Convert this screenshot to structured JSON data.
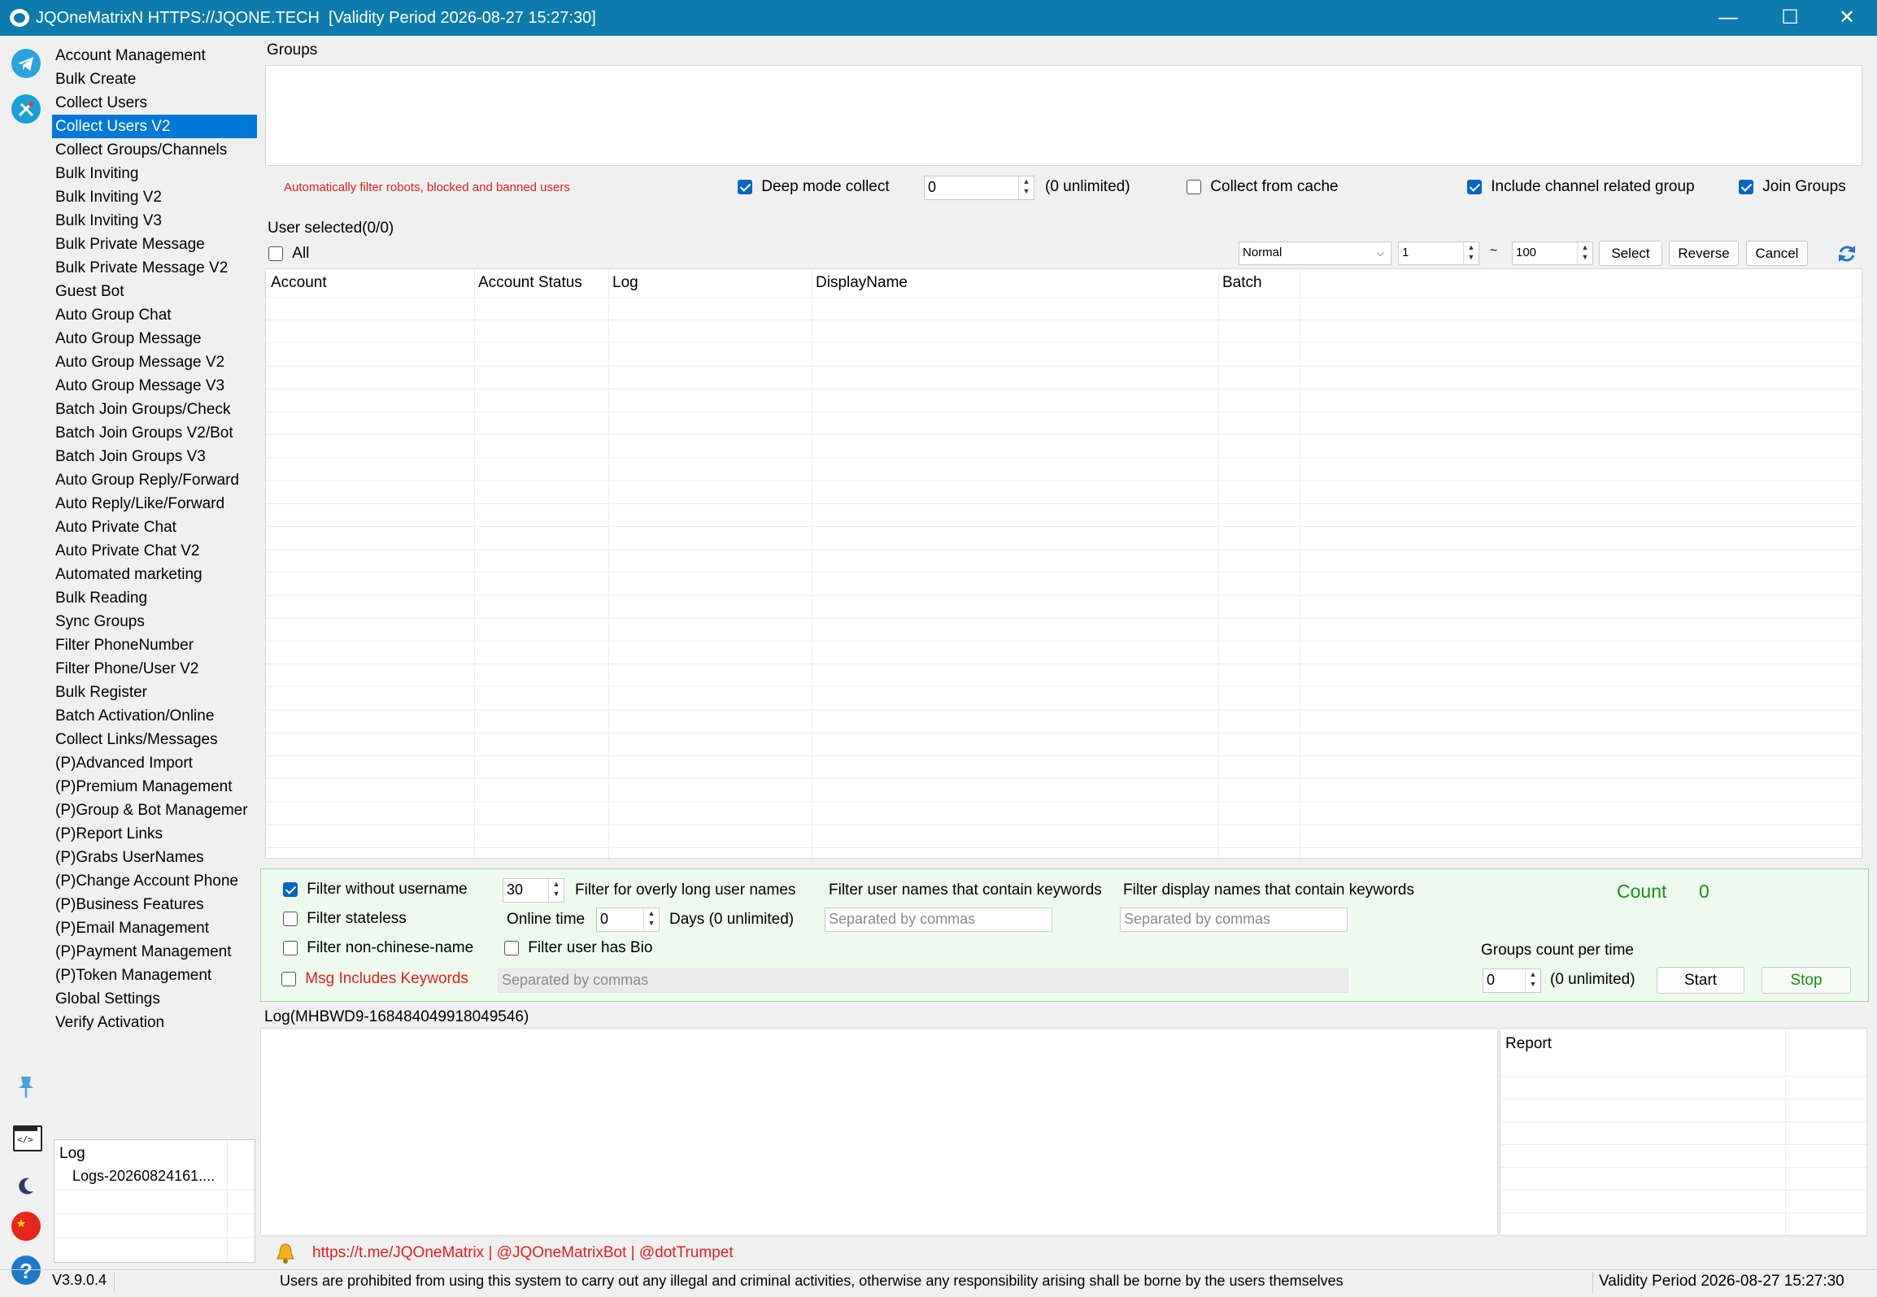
{
  "window": {
    "title": "JQOneMatrixN HTTPS://JQONE.TECH  [Validity Period 2026-08-27 15:27:30]",
    "minimize": "—",
    "maximize": "☐",
    "close": "✕"
  },
  "rail_icons": [
    "telegram-icon",
    "tools-icon",
    "pin-icon",
    "code-icon",
    "moon-icon",
    "china-flag-icon",
    "help-icon"
  ],
  "nav": {
    "items": [
      "Account Management",
      "Bulk Create",
      "Collect Users",
      "Collect Users V2",
      "Collect Groups/Channels",
      "Bulk Inviting",
      "Bulk Inviting V2",
      "Bulk Inviting V3",
      "Bulk Private Message",
      "Bulk Private Message V2",
      "Guest Bot",
      "Auto Group Chat",
      "Auto Group Message",
      "Auto Group Message V2",
      "Auto Group Message V3",
      "Batch Join Groups/Check",
      "Batch Join Groups V2/Bot",
      "Batch Join Groups V3",
      "Auto Group Reply/Forward",
      "Auto Reply/Like/Forward",
      "Auto Private Chat",
      "Auto Private Chat V2",
      "Automated marketing",
      "Bulk Reading",
      "Sync Groups",
      "Filter PhoneNumber",
      "Filter Phone/User V2",
      "Bulk Register",
      "Batch Activation/Online",
      "Collect Links/Messages",
      "(P)Advanced Import",
      "(P)Premium Management",
      "(P)Group & Bot Managemer",
      "(P)Report Links",
      "(P)Grabs UserNames",
      "(P)Change Account Phone",
      "(P)Business Features",
      "(P)Email Management",
      "(P)Payment Management",
      "(P)Token Management",
      "Global Settings",
      "Verify Activation"
    ],
    "selected_index": 3
  },
  "sidebar_log": {
    "header": "Log",
    "entry": "Logs-20260824161...."
  },
  "version": "V3.9.0.4",
  "groups": {
    "label": "Groups",
    "auto_filter_note": "Automatically filter robots, blocked and banned users",
    "deep_mode": {
      "label": "Deep mode collect",
      "checked": true
    },
    "deep_value": "0",
    "unlimited": "(0 unlimited)",
    "cache": {
      "label": "Collect from cache",
      "checked": false
    },
    "channel_related": {
      "label": "Include channel related group",
      "checked": true
    },
    "join_groups": {
      "label": "Join Groups",
      "checked": true
    }
  },
  "users": {
    "label": "User selected(0/0)",
    "all_label": "All",
    "mode_select": "Normal",
    "range_from": "1",
    "tilde": "~",
    "range_to": "100",
    "select_btn": "Select",
    "reverse_btn": "Reverse",
    "cancel_btn": "Cancel",
    "columns": [
      "Account",
      "Account Status",
      "Log",
      "DisplayName",
      "Batch"
    ]
  },
  "filters": {
    "without_username": {
      "label": "Filter without username",
      "checked": true
    },
    "stateless": {
      "label": "Filter stateless",
      "checked": false
    },
    "non_chinese": {
      "label": "Filter non-chinese-name",
      "checked": false
    },
    "msg_keywords": {
      "label": "Msg Includes Keywords",
      "checked": false
    },
    "long_name_value": "30",
    "long_name_label": "Filter for overly long user names",
    "online_time_label": "Online time",
    "online_time_value": "0",
    "days_label": "Days (0 unlimited)",
    "has_bio": {
      "label": "Filter user has Bio",
      "checked": false
    },
    "user_kw_label": "Filter user names that contain keywords",
    "display_kw_label": "Filter display names that contain keywords",
    "placeholder": "Separated by commas",
    "count_label": "Count",
    "count_value": "0",
    "groups_per_time_label": "Groups count per time",
    "groups_per_time_value": "0",
    "unlimited": "(0 unlimited)",
    "start_btn": "Start",
    "stop_btn": "Stop"
  },
  "log": {
    "label": "Log(MHBWD9-168484049918049546)",
    "report_header": "Report"
  },
  "footer": {
    "links": "https://t.me/JQOneMatrix | @JQOneMatrixBot | @dotTrumpet",
    "disclaimer": "Users are prohibited from using this system to carry out any illegal and criminal activities, otherwise any responsibility arising shall be borne by the users themselves",
    "validity": "Validity Period 2026-08-27 15:27:30"
  },
  "colors": {
    "titlebar": "#0d7bab",
    "selection": "#0078d7",
    "warning_red": "#e02020",
    "green": "#1a8c1a",
    "filter_bg": "#eefaee"
  }
}
